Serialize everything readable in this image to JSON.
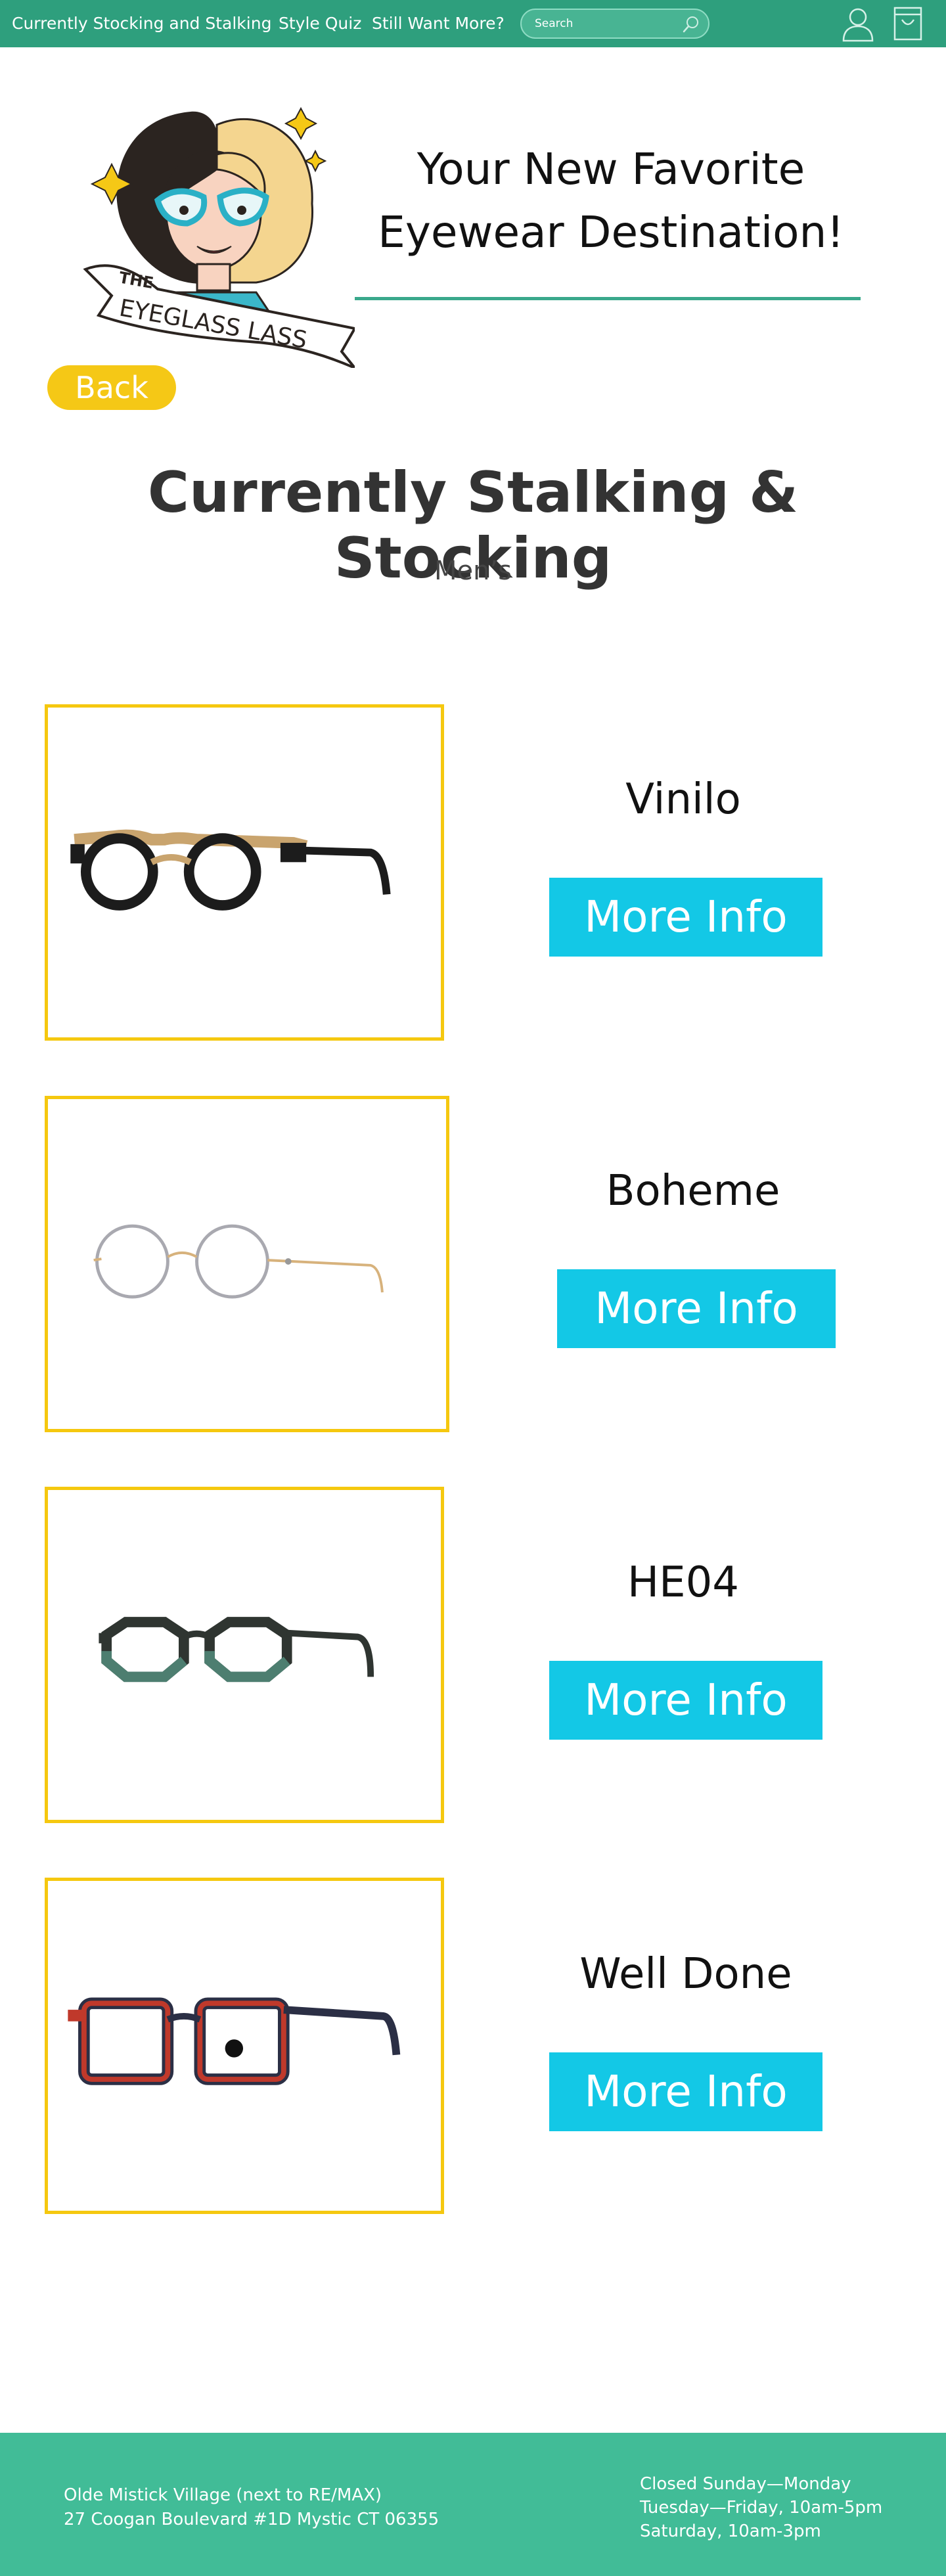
{
  "nav": {
    "links": [
      "Currently Stocking and Stalking",
      "Style Quiz",
      "Still Want More?"
    ],
    "search_placeholder": "Search",
    "icons": [
      "user-icon",
      "bag-icon",
      "search-icon"
    ],
    "bg_color": "#2e9f7d"
  },
  "header": {
    "logo_text": [
      "THE",
      "EYEGLASS LASS"
    ],
    "tagline_line1": "Your New Favorite",
    "tagline_line2": "Eyewear Destination!"
  },
  "back_label": "Back",
  "page_title": "Currently Stalking & Stocking",
  "subtitle": "Men’s",
  "products": [
    {
      "name": "Vinilo",
      "button": "More Info"
    },
    {
      "name": "Boheme",
      "button": "More Info"
    },
    {
      "name": "HE04",
      "button": "More Info"
    },
    {
      "name": "Well Done",
      "button": "More Info"
    }
  ],
  "footer": {
    "address_line1": "Olde Mistick Village (next to RE/MAX)",
    "address_line2": "27 Coogan Boulevard #1D Mystic CT 06355",
    "hours_line1": "Closed Sunday—Monday",
    "hours_line2": "Tuesday—Friday, 10am-5pm",
    "hours_line3": "Saturday,  10am-3pm"
  },
  "colors": {
    "accent_yellow": "#f5c816",
    "button_cyan": "#13c8e6",
    "footer_green": "#41bc97",
    "rule_teal": "#3aa88c"
  }
}
